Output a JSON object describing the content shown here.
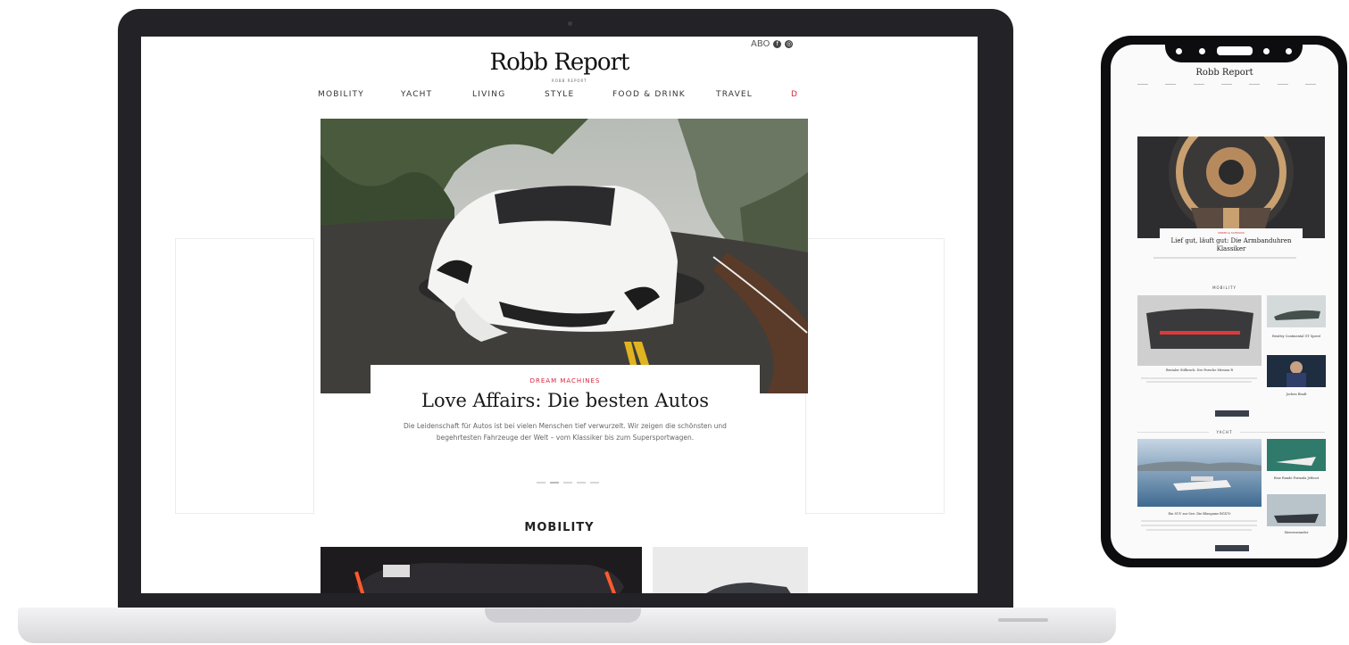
{
  "laptop_site": {
    "logo": "Robb Report",
    "logo_sub": "ROBB REPORT",
    "util": {
      "login": "ABO",
      "facebook_icon": "f",
      "instagram_icon": "◎"
    },
    "nav": [
      "MOBILITY",
      "YACHT",
      "LIVING",
      "STYLE",
      "FOOD & DRINK",
      "TRAVEL",
      "D"
    ],
    "hero": {
      "kicker": "DREAM MACHINES",
      "headline": "Love Affairs: Die besten Autos",
      "teaser": "Die Leidenschaft für Autos ist bei vielen Menschen tief verwurzelt. Wir zeigen die schönsten und begehrtesten Fahrzeuge der Welt – vom Klassiker bis zum Supersportwagen."
    },
    "section_title": "MOBILITY"
  },
  "phone_site": {
    "logo": "Robb Report",
    "hero": {
      "kicker": "UHREN & SCHMUCK",
      "headline": "Lief gut, läuft gut: Die Armbanduhren Klassiker"
    },
    "sections": [
      "MOBILITY",
      "YACHT"
    ],
    "mobility_main_caption": "Brutaler Stilbruch: Der Porsche Mission R",
    "mobility_side_captions": [
      "Bentley Continental GT Speed",
      "Jochen Rindt"
    ],
    "yacht_main_caption": "Ein SUV zur See: Die Bluegame BGX70",
    "yacht_side_captions": [
      "Eine Runde Formula Jetboot",
      "Meereswunder"
    ]
  },
  "colors": {
    "accent": "#d9243d",
    "device": "#232327",
    "button": "#3a3f4c"
  }
}
